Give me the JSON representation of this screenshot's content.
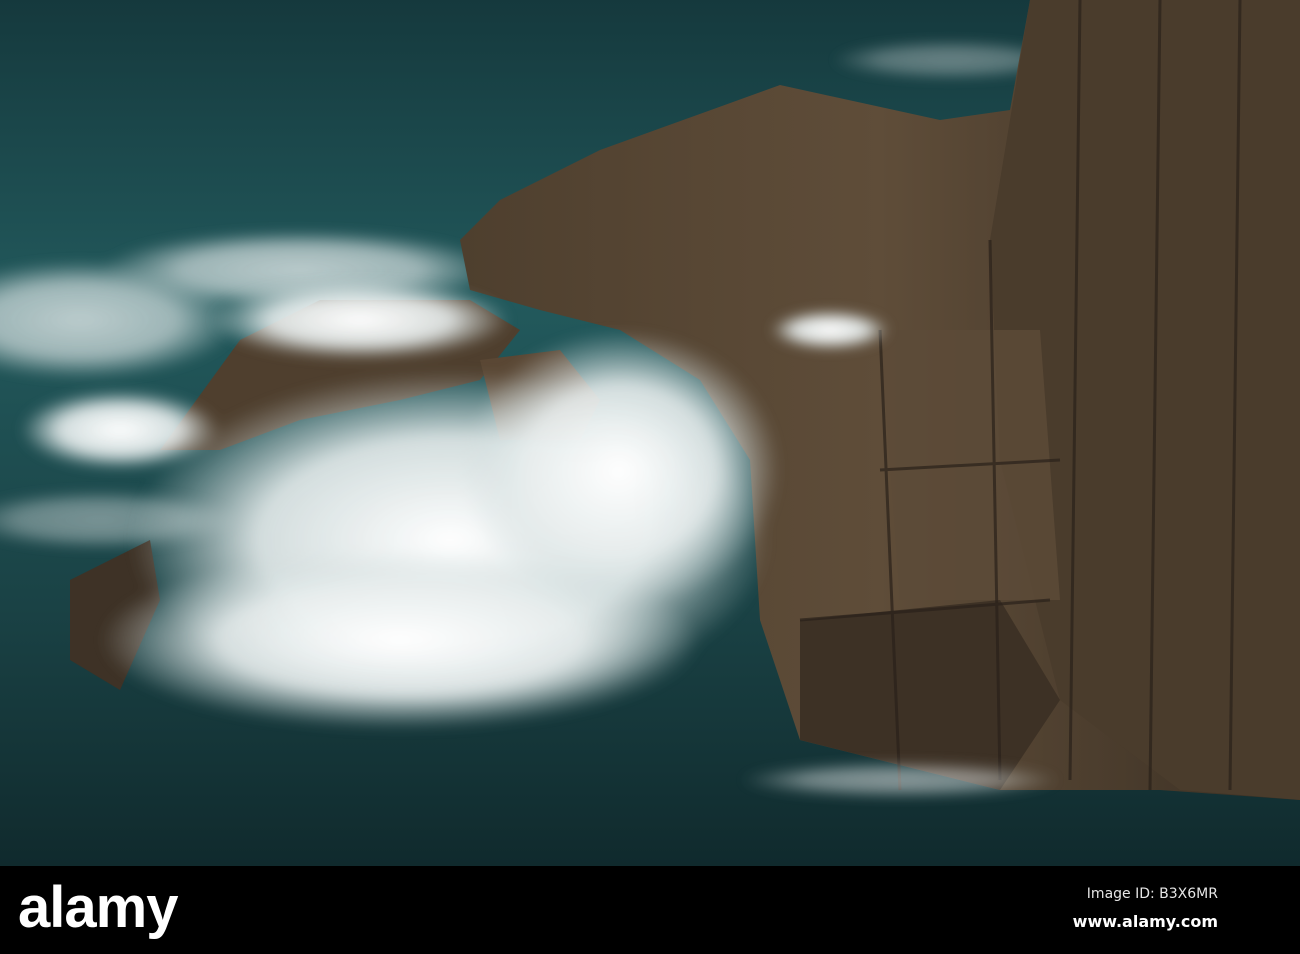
{
  "photo": {
    "subject": "waves-on-rocky-coast",
    "colors": {
      "sea": "#1f4a4e",
      "sea_dark": "#123236",
      "foam": "#f2f4f2",
      "rock": "#5a4a38",
      "rock_dark": "#2e251c"
    }
  },
  "watermark": {
    "logo": "alamy",
    "image_id": "Image ID: B3X6MR",
    "url": "www.alamy.com"
  }
}
